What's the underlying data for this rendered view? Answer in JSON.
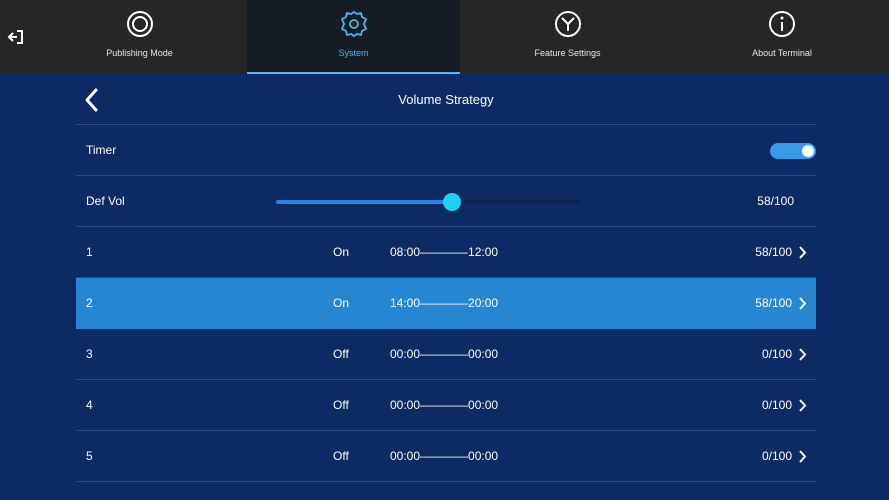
{
  "nav": {
    "exit_icon": "exit-icon",
    "tabs": [
      {
        "label": "Publishing Mode",
        "icon": "publishing-mode-icon",
        "active": false
      },
      {
        "label": "System",
        "icon": "gear-icon",
        "active": true
      },
      {
        "label": "Feature Settings",
        "icon": "feature-settings-icon",
        "active": false
      },
      {
        "label": "About Terminal",
        "icon": "info-icon",
        "active": false
      }
    ]
  },
  "page": {
    "title": "Volume Strategy",
    "back_icon": "chevron-left-icon"
  },
  "timer": {
    "label": "Timer",
    "enabled": true
  },
  "def_vol": {
    "label": "Def Vol",
    "value": 58,
    "max": 100,
    "value_text": "58/100"
  },
  "schedules": [
    {
      "index": "1",
      "state": "On",
      "range": "08:00————12:00",
      "volume": "58/100",
      "selected": false
    },
    {
      "index": "2",
      "state": "On",
      "range": "14:00————20:00",
      "volume": "58/100",
      "selected": true
    },
    {
      "index": "3",
      "state": "Off",
      "range": "00:00————00:00",
      "volume": "0/100",
      "selected": false
    },
    {
      "index": "4",
      "state": "Off",
      "range": "00:00————00:00",
      "volume": "0/100",
      "selected": false
    },
    {
      "index": "5",
      "state": "Off",
      "range": "00:00————00:00",
      "volume": "0/100",
      "selected": false
    }
  ],
  "colors": {
    "background": "#0c2a63",
    "nav_background": "#262626",
    "active_tab": "#4fb3ef",
    "selected_row": "#2686d1",
    "toggle_on": "#3a9ae8",
    "slider_thumb": "#1fd0f5"
  }
}
